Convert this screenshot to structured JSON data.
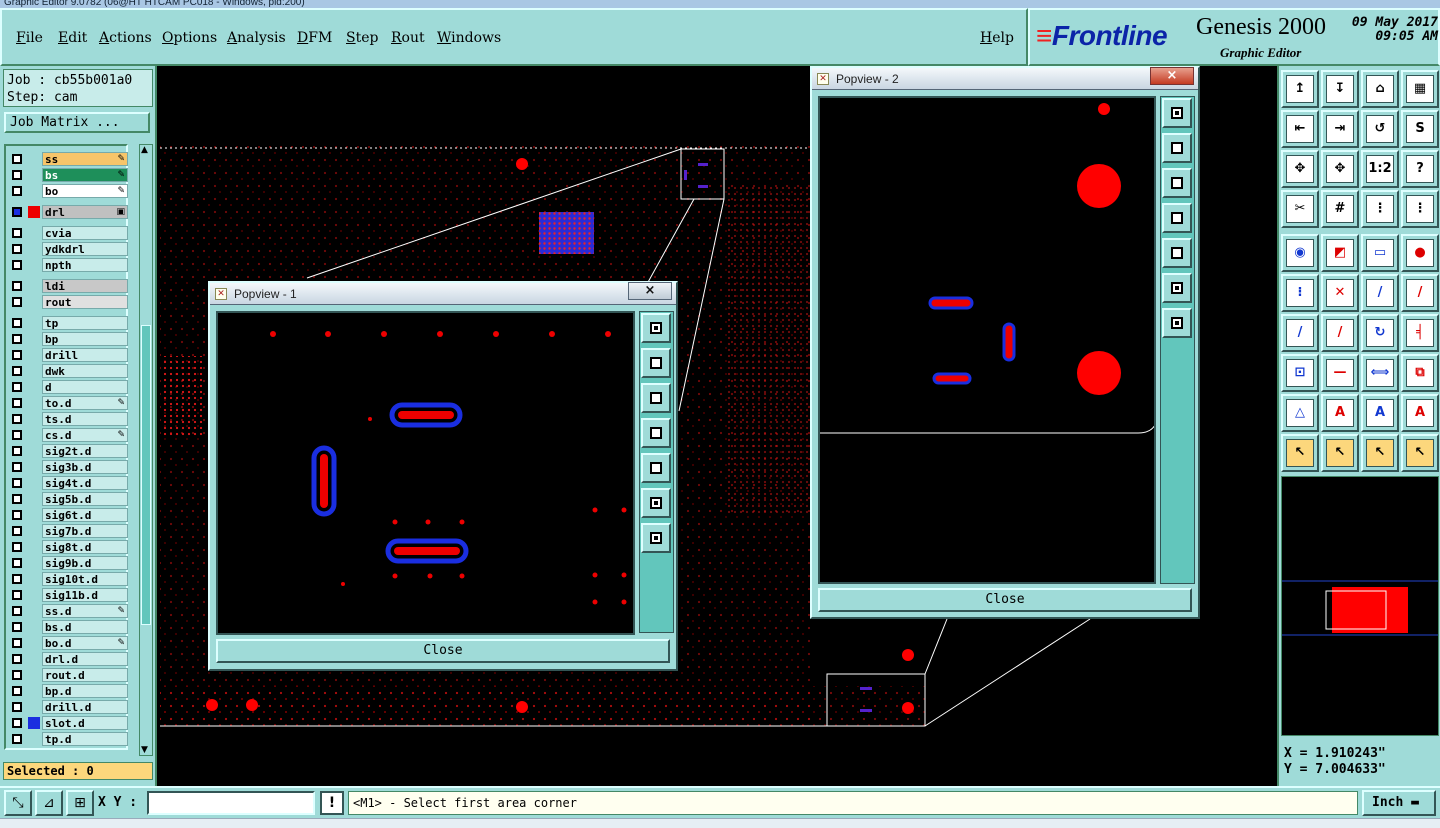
{
  "window": {
    "title": "Graphic Editor 9.0782 (06@HT HTCAM PC018 - Windows, pid:200)"
  },
  "menu": [
    "File",
    "Edit",
    "Actions",
    "Options",
    "Analysis",
    "DFM",
    "Step",
    "Rout",
    "Windows"
  ],
  "help": "Help",
  "brand": {
    "logo": "Frontline",
    "name": "Genesis 2000",
    "sub": "Graphic Editor",
    "date": "09 May 2017",
    "time": "09:05 AM"
  },
  "job": {
    "job_line": "Job : cb55b001a0",
    "step_line": "Step: cam",
    "matrix_button": "Job Matrix ..."
  },
  "layers": [
    {
      "name": "ss",
      "color": "#f7c56a",
      "icon": "✎"
    },
    {
      "name": "bs",
      "color": "#1e8f5a",
      "icon": "✎"
    },
    {
      "name": "bo",
      "color": "#ffffff",
      "icon": "✎"
    },
    {
      "name": "drl",
      "color": "#c0c0c0",
      "icon": "▣",
      "swatch": "#e00",
      "active": true
    },
    {
      "name": "cvia"
    },
    {
      "name": "ydkdrl"
    },
    {
      "name": "npth"
    },
    {
      "name": "ldi",
      "color": "#c8c8c8"
    },
    {
      "name": "rout",
      "color": "#e0e0e0"
    },
    {
      "name": "tp"
    },
    {
      "name": "bp"
    },
    {
      "name": "drill"
    },
    {
      "name": "dwk"
    },
    {
      "name": "d"
    },
    {
      "name": "to.d",
      "icon": "✎"
    },
    {
      "name": "ts.d"
    },
    {
      "name": "cs.d",
      "icon": "✎"
    },
    {
      "name": "sig2t.d"
    },
    {
      "name": "sig3b.d"
    },
    {
      "name": "sig4t.d"
    },
    {
      "name": "sig5b.d"
    },
    {
      "name": "sig6t.d"
    },
    {
      "name": "sig7b.d"
    },
    {
      "name": "sig8t.d"
    },
    {
      "name": "sig9b.d"
    },
    {
      "name": "sig10t.d"
    },
    {
      "name": "sig11b.d"
    },
    {
      "name": "ss.d",
      "icon": "✎"
    },
    {
      "name": "bs.d"
    },
    {
      "name": "bo.d",
      "icon": "✎"
    },
    {
      "name": "drl.d"
    },
    {
      "name": "rout.d"
    },
    {
      "name": "bp.d"
    },
    {
      "name": "drill.d"
    },
    {
      "name": "slot.d",
      "swatch": "#1a2ee0"
    },
    {
      "name": "tp.d"
    }
  ],
  "selected": "Selected : 0",
  "popview1": {
    "title": "Popview - 1",
    "close": "Close",
    "x": "×"
  },
  "popview2": {
    "title": "Popview - 2",
    "close": "Close",
    "x": "×"
  },
  "tools": [
    [
      "↥",
      "↧",
      "⌂",
      "▦"
    ],
    [
      "⇤",
      "⇥",
      "↺",
      "S"
    ],
    [
      "✥",
      "✥",
      "1:2",
      "?"
    ],
    [
      "✂",
      "#",
      "⋮",
      "⋮"
    ],
    [
      "◉",
      "◩",
      "▭",
      "●"
    ],
    [
      "⁝",
      "✕",
      "/",
      "/"
    ],
    [
      "/",
      "/",
      "↻",
      "╡"
    ],
    [
      "⊡",
      "—",
      "⟺",
      "⧉"
    ],
    [
      "△",
      "A",
      "A",
      "A"
    ],
    [
      "↖",
      "↖",
      "↖",
      "↖"
    ]
  ],
  "coords": {
    "x": "X = 1.910243\"",
    "y": "Y = 7.004633\""
  },
  "status": {
    "xy_label": "X Y :",
    "xy_value": "",
    "message": "<M1> - Select first area corner",
    "unit": "Inch ▬",
    "warn": "!"
  }
}
